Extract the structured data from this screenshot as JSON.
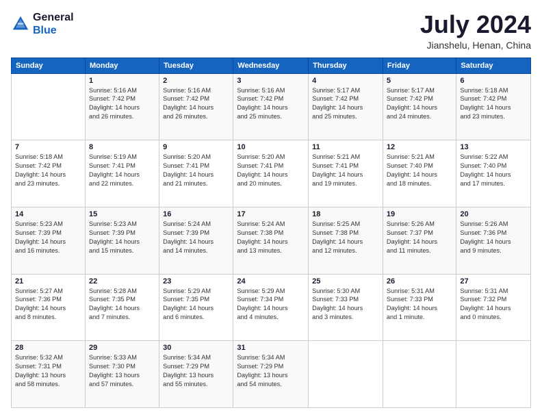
{
  "logo": {
    "text_general": "General",
    "text_blue": "Blue"
  },
  "title": {
    "month_year": "July 2024",
    "location": "Jianshelu, Henan, China"
  },
  "weekdays": [
    "Sunday",
    "Monday",
    "Tuesday",
    "Wednesday",
    "Thursday",
    "Friday",
    "Saturday"
  ],
  "weeks": [
    [
      {
        "day": "",
        "info": ""
      },
      {
        "day": "1",
        "info": "Sunrise: 5:16 AM\nSunset: 7:42 PM\nDaylight: 14 hours\nand 26 minutes."
      },
      {
        "day": "2",
        "info": "Sunrise: 5:16 AM\nSunset: 7:42 PM\nDaylight: 14 hours\nand 26 minutes."
      },
      {
        "day": "3",
        "info": "Sunrise: 5:16 AM\nSunset: 7:42 PM\nDaylight: 14 hours\nand 25 minutes."
      },
      {
        "day": "4",
        "info": "Sunrise: 5:17 AM\nSunset: 7:42 PM\nDaylight: 14 hours\nand 25 minutes."
      },
      {
        "day": "5",
        "info": "Sunrise: 5:17 AM\nSunset: 7:42 PM\nDaylight: 14 hours\nand 24 minutes."
      },
      {
        "day": "6",
        "info": "Sunrise: 5:18 AM\nSunset: 7:42 PM\nDaylight: 14 hours\nand 23 minutes."
      }
    ],
    [
      {
        "day": "7",
        "info": "Sunrise: 5:18 AM\nSunset: 7:42 PM\nDaylight: 14 hours\nand 23 minutes."
      },
      {
        "day": "8",
        "info": "Sunrise: 5:19 AM\nSunset: 7:41 PM\nDaylight: 14 hours\nand 22 minutes."
      },
      {
        "day": "9",
        "info": "Sunrise: 5:20 AM\nSunset: 7:41 PM\nDaylight: 14 hours\nand 21 minutes."
      },
      {
        "day": "10",
        "info": "Sunrise: 5:20 AM\nSunset: 7:41 PM\nDaylight: 14 hours\nand 20 minutes."
      },
      {
        "day": "11",
        "info": "Sunrise: 5:21 AM\nSunset: 7:41 PM\nDaylight: 14 hours\nand 19 minutes."
      },
      {
        "day": "12",
        "info": "Sunrise: 5:21 AM\nSunset: 7:40 PM\nDaylight: 14 hours\nand 18 minutes."
      },
      {
        "day": "13",
        "info": "Sunrise: 5:22 AM\nSunset: 7:40 PM\nDaylight: 14 hours\nand 17 minutes."
      }
    ],
    [
      {
        "day": "14",
        "info": "Sunrise: 5:23 AM\nSunset: 7:39 PM\nDaylight: 14 hours\nand 16 minutes."
      },
      {
        "day": "15",
        "info": "Sunrise: 5:23 AM\nSunset: 7:39 PM\nDaylight: 14 hours\nand 15 minutes."
      },
      {
        "day": "16",
        "info": "Sunrise: 5:24 AM\nSunset: 7:39 PM\nDaylight: 14 hours\nand 14 minutes."
      },
      {
        "day": "17",
        "info": "Sunrise: 5:24 AM\nSunset: 7:38 PM\nDaylight: 14 hours\nand 13 minutes."
      },
      {
        "day": "18",
        "info": "Sunrise: 5:25 AM\nSunset: 7:38 PM\nDaylight: 14 hours\nand 12 minutes."
      },
      {
        "day": "19",
        "info": "Sunrise: 5:26 AM\nSunset: 7:37 PM\nDaylight: 14 hours\nand 11 minutes."
      },
      {
        "day": "20",
        "info": "Sunrise: 5:26 AM\nSunset: 7:36 PM\nDaylight: 14 hours\nand 9 minutes."
      }
    ],
    [
      {
        "day": "21",
        "info": "Sunrise: 5:27 AM\nSunset: 7:36 PM\nDaylight: 14 hours\nand 8 minutes."
      },
      {
        "day": "22",
        "info": "Sunrise: 5:28 AM\nSunset: 7:35 PM\nDaylight: 14 hours\nand 7 minutes."
      },
      {
        "day": "23",
        "info": "Sunrise: 5:29 AM\nSunset: 7:35 PM\nDaylight: 14 hours\nand 6 minutes."
      },
      {
        "day": "24",
        "info": "Sunrise: 5:29 AM\nSunset: 7:34 PM\nDaylight: 14 hours\nand 4 minutes."
      },
      {
        "day": "25",
        "info": "Sunrise: 5:30 AM\nSunset: 7:33 PM\nDaylight: 14 hours\nand 3 minutes."
      },
      {
        "day": "26",
        "info": "Sunrise: 5:31 AM\nSunset: 7:33 PM\nDaylight: 14 hours\nand 1 minute."
      },
      {
        "day": "27",
        "info": "Sunrise: 5:31 AM\nSunset: 7:32 PM\nDaylight: 14 hours\nand 0 minutes."
      }
    ],
    [
      {
        "day": "28",
        "info": "Sunrise: 5:32 AM\nSunset: 7:31 PM\nDaylight: 13 hours\nand 58 minutes."
      },
      {
        "day": "29",
        "info": "Sunrise: 5:33 AM\nSunset: 7:30 PM\nDaylight: 13 hours\nand 57 minutes."
      },
      {
        "day": "30",
        "info": "Sunrise: 5:34 AM\nSunset: 7:29 PM\nDaylight: 13 hours\nand 55 minutes."
      },
      {
        "day": "31",
        "info": "Sunrise: 5:34 AM\nSunset: 7:29 PM\nDaylight: 13 hours\nand 54 minutes."
      },
      {
        "day": "",
        "info": ""
      },
      {
        "day": "",
        "info": ""
      },
      {
        "day": "",
        "info": ""
      }
    ]
  ]
}
